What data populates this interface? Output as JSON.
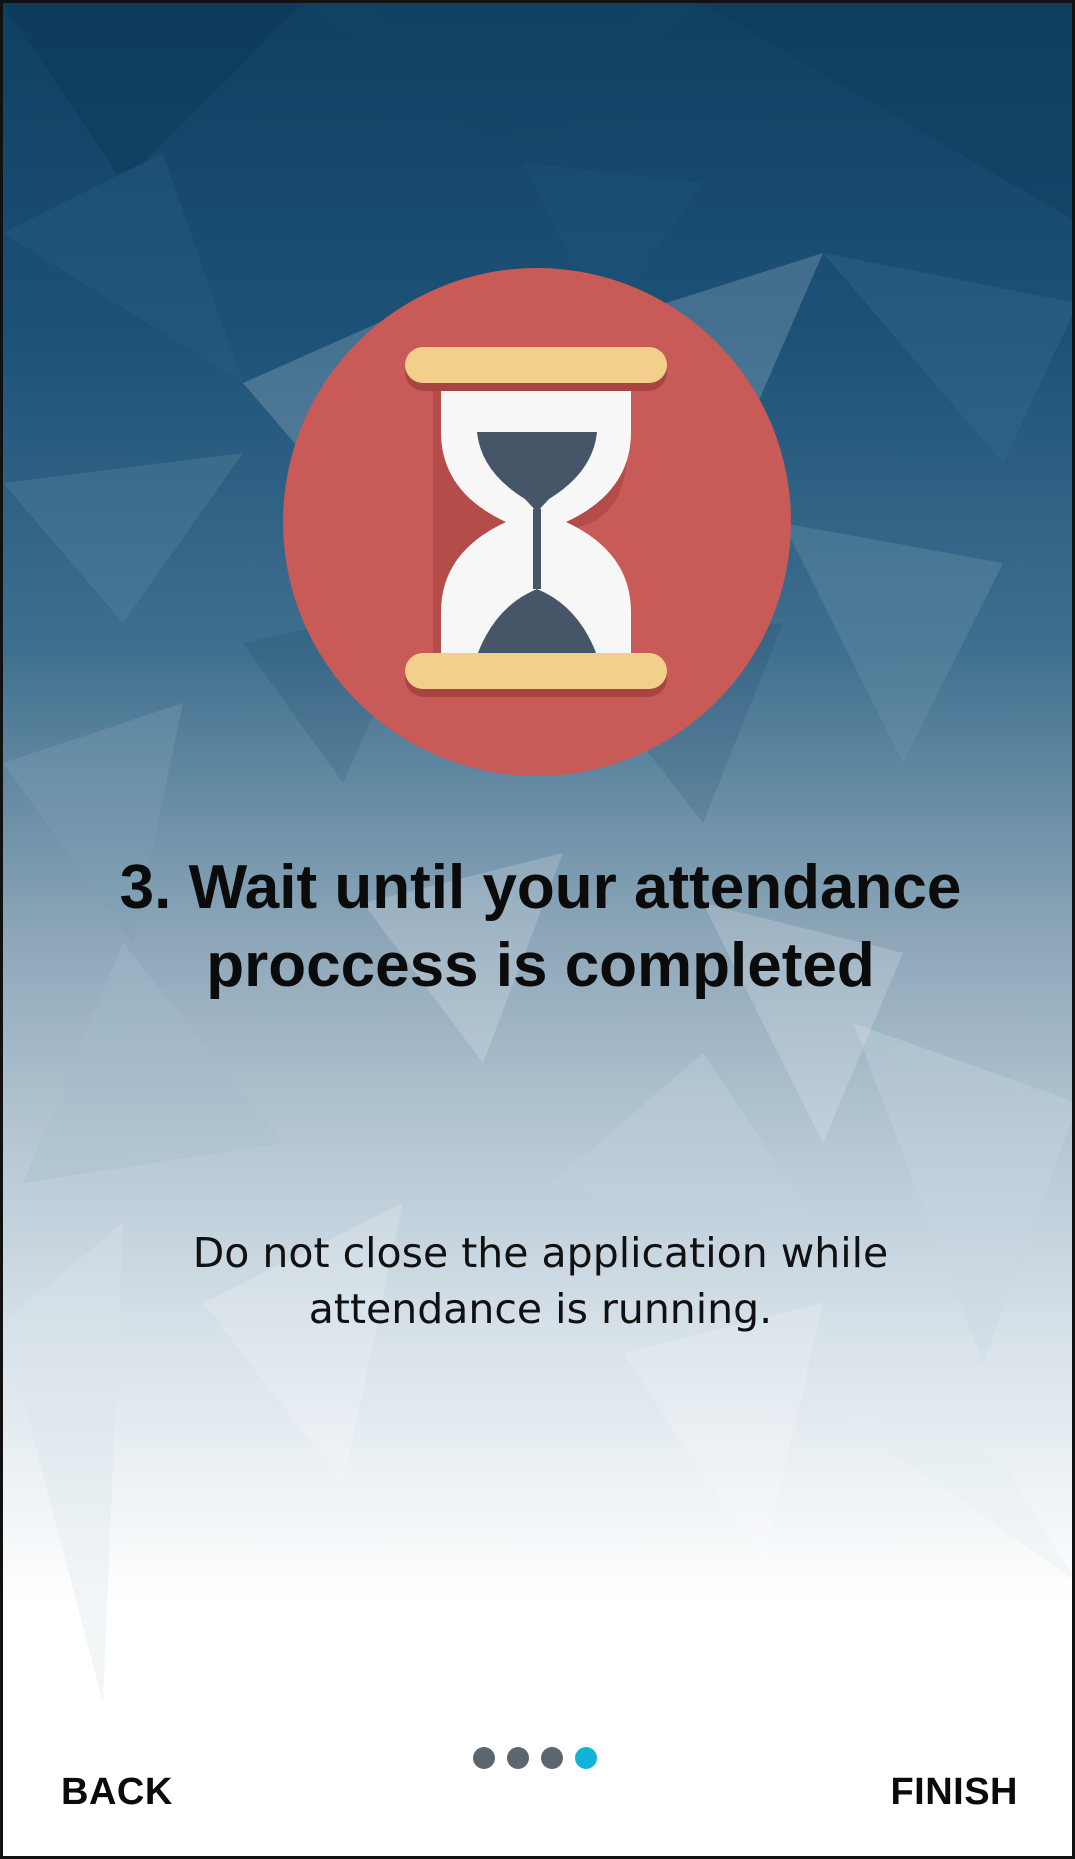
{
  "onboarding": {
    "title": "3. Wait until your attendance proccess is completed",
    "subtitle": "Do not close the application while attendance is running.",
    "illustration_icon": "hourglass-icon",
    "pager": {
      "total": 4,
      "current": 4
    },
    "back_label": "BACK",
    "finish_label": "FINISH"
  },
  "colors": {
    "background_top": "#0f3f60",
    "background_bottom": "#ffffff",
    "icon_circle": "#c85a58",
    "hourglass_caps": "#f2cf8a",
    "hourglass_glass": "#f7f7f7",
    "hourglass_sand": "#475569",
    "dot_inactive": "#5b6670",
    "dot_active": "#12b3d6"
  }
}
